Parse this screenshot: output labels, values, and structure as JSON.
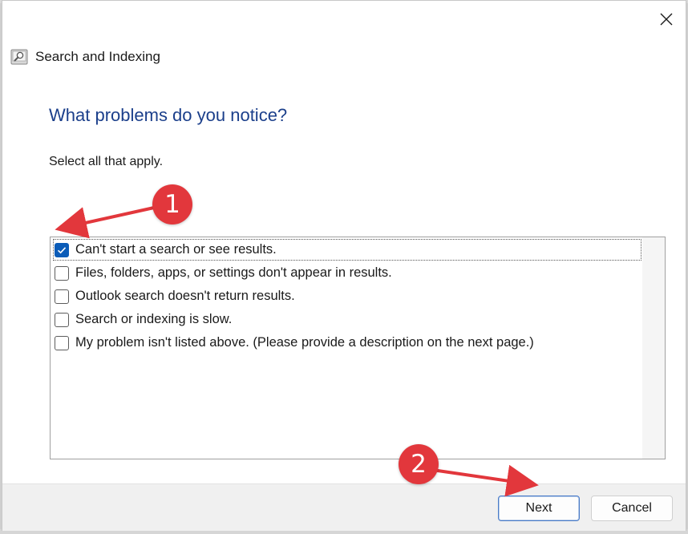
{
  "window": {
    "title": "Search and Indexing",
    "close_icon": "close-icon",
    "app_icon": "search-indexing-icon"
  },
  "page": {
    "heading": "What problems do you notice?",
    "instruction": "Select all that apply."
  },
  "problems": [
    {
      "label": "Can't start a search or see results.",
      "checked": true
    },
    {
      "label": "Files, folders, apps, or settings don't appear in results.",
      "checked": false
    },
    {
      "label": "Outlook search doesn't return results.",
      "checked": false
    },
    {
      "label": "Search or indexing is slow.",
      "checked": false
    },
    {
      "label": "My problem isn't listed above. (Please provide a description on the next page.)",
      "checked": false
    }
  ],
  "buttons": {
    "next": "Next",
    "cancel": "Cancel"
  },
  "annotations": [
    {
      "number": "1"
    },
    {
      "number": "2"
    }
  ],
  "colors": {
    "heading": "#1b3f8b",
    "checkbox_checked": "#0b5cb8",
    "annotation": "#e2373c"
  }
}
